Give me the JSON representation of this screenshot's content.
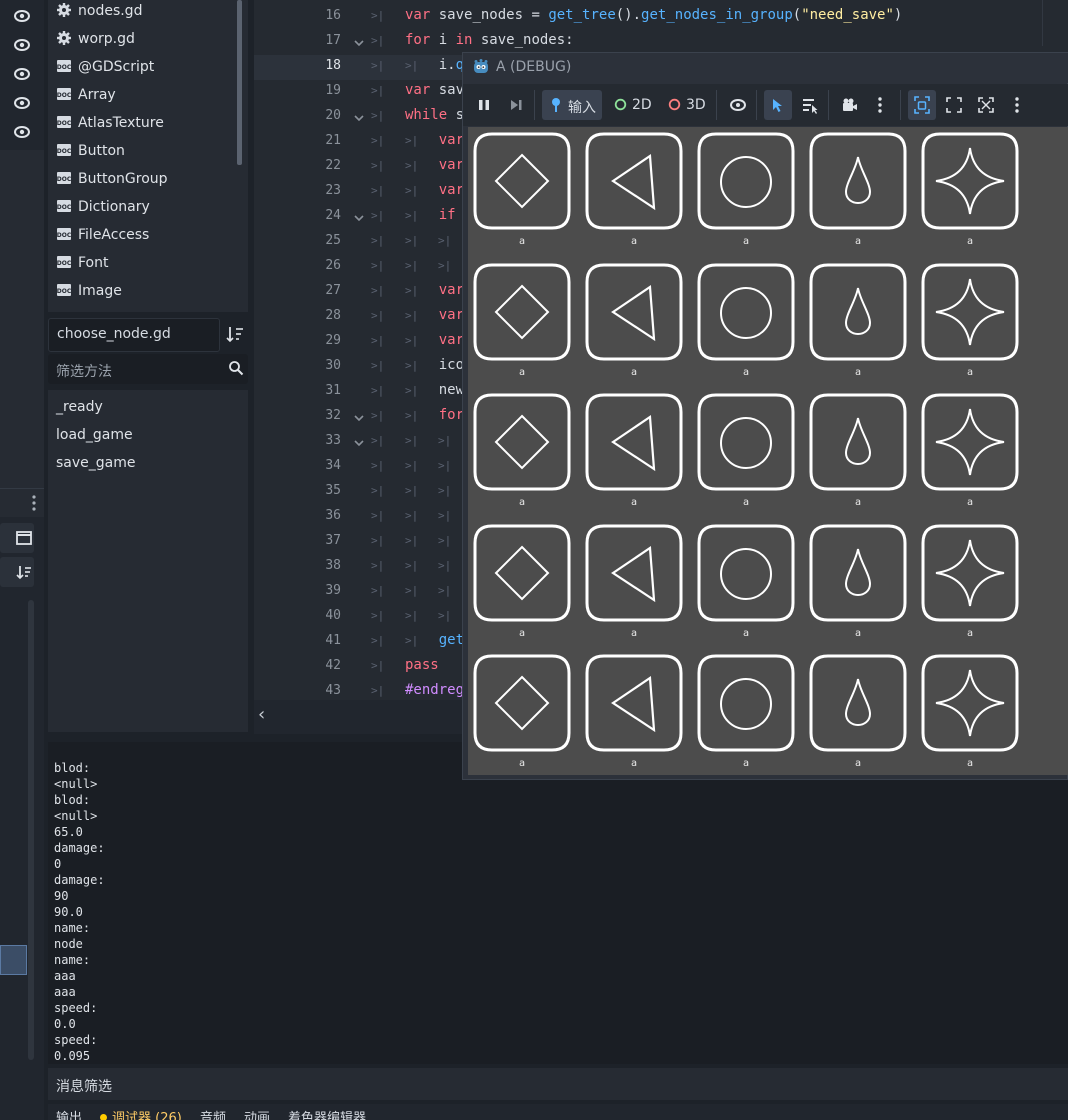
{
  "scripts": {
    "items": [
      {
        "label": "nodes.gd",
        "icon": "gear-icon"
      },
      {
        "label": "worp.gd",
        "icon": "gear-icon"
      },
      {
        "label": "@GDScript",
        "icon": "doc-icon"
      },
      {
        "label": "Array",
        "icon": "doc-icon"
      },
      {
        "label": "AtlasTexture",
        "icon": "doc-icon"
      },
      {
        "label": "Button",
        "icon": "doc-icon"
      },
      {
        "label": "ButtonGroup",
        "icon": "doc-icon"
      },
      {
        "label": "Dictionary",
        "icon": "doc-icon"
      },
      {
        "label": "FileAccess",
        "icon": "doc-icon"
      },
      {
        "label": "Font",
        "icon": "doc-icon"
      },
      {
        "label": "Image",
        "icon": "doc-icon"
      }
    ],
    "current_script": "choose_node.gd",
    "filter_placeholder": "筛选方法"
  },
  "methods": [
    "_ready",
    "load_game",
    "save_game"
  ],
  "editor": {
    "lines": [
      {
        "n": "16",
        "code": [
          [
            "kw",
            "var"
          ],
          [
            "",
            "  save_nodes = "
          ],
          [
            "fn",
            "get_tree"
          ],
          [
            "",
            "()."
          ],
          [
            "fn",
            "get_nodes_in_group"
          ],
          [
            "",
            "("
          ],
          [
            "str",
            "\"need_save\""
          ],
          [
            "",
            ")"
          ]
        ]
      },
      {
        "n": "17",
        "code": [
          [
            "kw",
            "for"
          ],
          [
            "",
            " i "
          ],
          [
            "kw",
            "in"
          ],
          [
            "",
            " save_nodes:"
          ]
        ]
      },
      {
        "n": "18",
        "code": [
          [
            "",
            "      i."
          ],
          [
            "fn",
            "q"
          ]
        ]
      },
      {
        "n": "19",
        "code": [
          [
            "kw",
            "var"
          ],
          [
            "",
            " sav"
          ]
        ]
      },
      {
        "n": "20",
        "code": [
          [
            "kw",
            "while"
          ],
          [
            "",
            " s"
          ]
        ]
      },
      {
        "n": "21",
        "code": [
          [
            "",
            "      "
          ],
          [
            "kw",
            "var"
          ]
        ]
      },
      {
        "n": "22",
        "code": [
          [
            "",
            "      "
          ],
          [
            "kw",
            "var"
          ]
        ]
      },
      {
        "n": "23",
        "code": [
          [
            "",
            "      "
          ],
          [
            "kw",
            "var"
          ]
        ]
      },
      {
        "n": "24",
        "code": [
          [
            "",
            "      "
          ],
          [
            "kw",
            "if"
          ]
        ]
      },
      {
        "n": "25",
        "code": []
      },
      {
        "n": "26",
        "code": []
      },
      {
        "n": "27",
        "code": [
          [
            "",
            "      "
          ],
          [
            "kw",
            "var"
          ]
        ]
      },
      {
        "n": "28",
        "code": [
          [
            "",
            "      "
          ],
          [
            "kw",
            "var"
          ]
        ]
      },
      {
        "n": "29",
        "code": [
          [
            "",
            "      "
          ],
          [
            "kw",
            "var"
          ]
        ]
      },
      {
        "n": "30",
        "code": [
          [
            "",
            "      ico"
          ]
        ]
      },
      {
        "n": "31",
        "code": [
          [
            "",
            "      new"
          ]
        ]
      },
      {
        "n": "32",
        "code": [
          [
            "",
            "      "
          ],
          [
            "kw",
            "for"
          ]
        ]
      },
      {
        "n": "33",
        "code": []
      },
      {
        "n": "34",
        "code": []
      },
      {
        "n": "35",
        "code": []
      },
      {
        "n": "36",
        "code": []
      },
      {
        "n": "37",
        "code": []
      },
      {
        "n": "38",
        "code": []
      },
      {
        "n": "39",
        "code": []
      },
      {
        "n": "40",
        "code": []
      },
      {
        "n": "41",
        "code": [
          [
            "",
            "      "
          ],
          [
            "fn",
            "get"
          ]
        ]
      },
      {
        "n": "42",
        "code": [
          [
            "kw",
            "pass"
          ]
        ]
      },
      {
        "n": "43",
        "code": [
          [
            "rg",
            "#endregion"
          ]
        ]
      }
    ],
    "current_line": "18",
    "folds": [
      "17",
      "20",
      "24",
      "32",
      "33"
    ]
  },
  "debug_window": {
    "title": "A (DEBUG)",
    "input_label": "输入",
    "mode_2d": "2D",
    "mode_3d": "3D"
  },
  "game": {
    "tile_label": "a",
    "rows": 5,
    "shapes": [
      "diamond",
      "triangle",
      "circle",
      "drop",
      "star"
    ]
  },
  "output": {
    "lines": [
      "blod:",
      "<null>",
      "blod:",
      "<null>",
      "65.0",
      "damage:",
      "0",
      "damage:",
      "90",
      "90.0",
      "name:",
      "node",
      "name:",
      "aaa",
      "aaa",
      "speed:",
      "0.0",
      "speed:",
      "0.095"
    ],
    "filter_placeholder": "消息筛选"
  },
  "bottom_tabs": [
    "输出",
    "调试器 (26)",
    "音频",
    "动画",
    "着色器编辑器"
  ],
  "colors": {
    "keyword": "#ff7085",
    "function": "#57b3ff",
    "string": "#ffeda1",
    "region": "#d08cff",
    "warning_dot": "#ffcc00"
  }
}
